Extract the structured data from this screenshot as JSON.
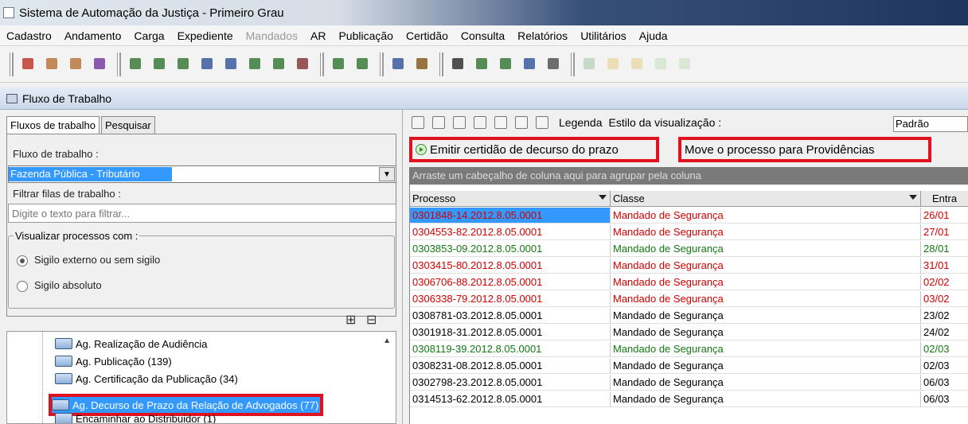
{
  "window": {
    "title": "Sistema de Automação da Justiça - Primeiro Grau"
  },
  "menu": [
    {
      "label": "Cadastro",
      "enabled": true
    },
    {
      "label": "Andamento",
      "enabled": true
    },
    {
      "label": "Carga",
      "enabled": true
    },
    {
      "label": "Expediente",
      "enabled": true
    },
    {
      "label": "Mandados",
      "enabled": false
    },
    {
      "label": "AR",
      "enabled": true
    },
    {
      "label": "Publicação",
      "enabled": true
    },
    {
      "label": "Certidão",
      "enabled": true
    },
    {
      "label": "Consulta",
      "enabled": true
    },
    {
      "label": "Relatórios",
      "enabled": true
    },
    {
      "label": "Utilitários",
      "enabled": true
    },
    {
      "label": "Ajuda",
      "enabled": true
    }
  ],
  "section": {
    "title": "Fluxo de Trabalho"
  },
  "left": {
    "tabs": [
      "Fluxos de trabalho",
      "Pesquisar"
    ],
    "flow_label": "Fluxo de trabalho :",
    "flow_value": "Fazenda Pública - Tributário",
    "filter_label": "Filtrar filas de trabalho :",
    "filter_placeholder": "Digite o texto para filtrar...",
    "vis_legend": "Visualizar processos com :",
    "radio1": "Sigilo externo ou sem sigilo",
    "radio2": "Sigilo absoluto",
    "tree": [
      "Ag. Realização de Audiência",
      "Ag. Publicação (139)",
      "Ag. Certificação da Publicação (34)",
      "Ag. Decurso de Prazo da Relação de Advogados (77)",
      "Encaminhar ao Distribuidor (1)"
    ]
  },
  "right": {
    "legend_label": "Legenda",
    "style_label": "Estilo da visualização :",
    "style_value": "Padrão",
    "action1": "Emitir certidão de decurso do prazo",
    "action2": "Move o processo para Providências",
    "group_hint": "Arraste um cabeçalho de coluna aqui para agrupar pela coluna",
    "columns": [
      "Processo",
      "Classe",
      "Entra"
    ],
    "rows": [
      {
        "p": "0301848-14.2012.8.05.0001",
        "c": "Mandado de Segurança",
        "e": "26/01",
        "color": "#d00000"
      },
      {
        "p": "0304553-82.2012.8.05.0001",
        "c": "Mandado de Segurança",
        "e": "27/01",
        "color": "#d00000"
      },
      {
        "p": "0303853-09.2012.8.05.0001",
        "c": "Mandado de Segurança",
        "e": "28/01",
        "color": "#137a13"
      },
      {
        "p": "0303415-80.2012.8.05.0001",
        "c": "Mandado de Segurança",
        "e": "31/01",
        "color": "#d00000"
      },
      {
        "p": "0306706-88.2012.8.05.0001",
        "c": "Mandado de Segurança",
        "e": "02/02",
        "color": "#d00000"
      },
      {
        "p": "0306338-79.2012.8.05.0001",
        "c": "Mandado de Segurança",
        "e": "03/02",
        "color": "#d00000"
      },
      {
        "p": "0308781-03.2012.8.05.0001",
        "c": "Mandado de Segurança",
        "e": "23/02",
        "color": "#000000"
      },
      {
        "p": "0301918-31.2012.8.05.0001",
        "c": "Mandado de Segurança",
        "e": "24/02",
        "color": "#000000"
      },
      {
        "p": "0308119-39.2012.8.05.0001",
        "c": "Mandado de Segurança",
        "e": "02/03",
        "color": "#137a13"
      },
      {
        "p": "0308231-08.2012.8.05.0001",
        "c": "Mandado de Segurança",
        "e": "02/03",
        "color": "#000000"
      },
      {
        "p": "0302798-23.2012.8.05.0001",
        "c": "Mandado de Segurança",
        "e": "06/03",
        "color": "#000000"
      },
      {
        "p": "0314513-62.2012.8.05.0001",
        "c": "Mandado de Segurança",
        "e": "06/03",
        "color": "#000000"
      }
    ]
  }
}
